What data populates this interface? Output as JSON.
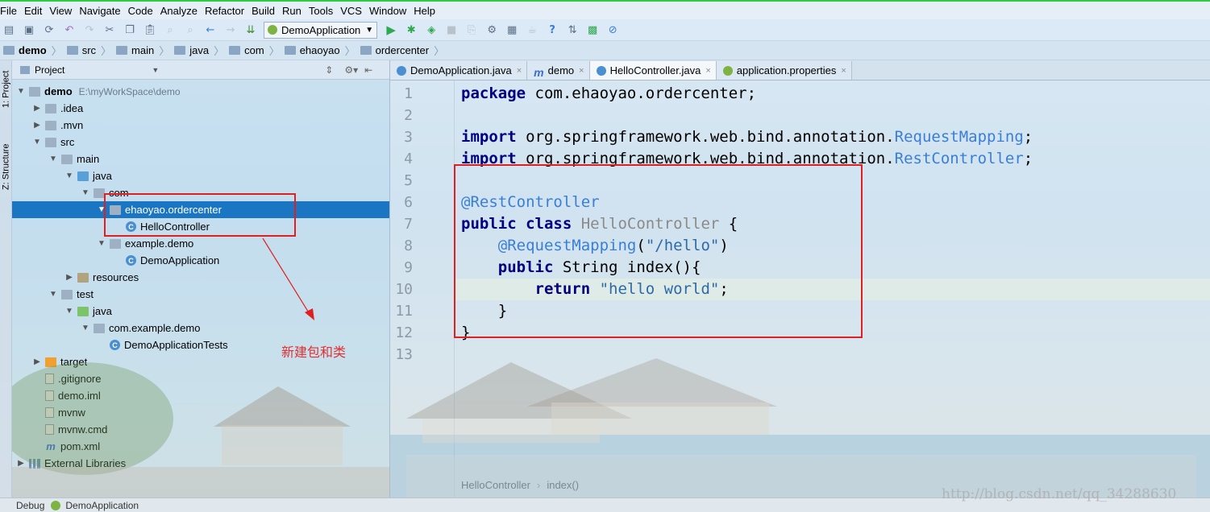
{
  "menu": [
    "File",
    "Edit",
    "View",
    "Navigate",
    "Code",
    "Analyze",
    "Refactor",
    "Build",
    "Run",
    "Tools",
    "VCS",
    "Window",
    "Help"
  ],
  "toolbar": {
    "run_config": "DemoApplication"
  },
  "breadcrumbs": [
    "demo",
    "src",
    "main",
    "java",
    "com",
    "ehaoyao",
    "ordercenter"
  ],
  "side_tabs": {
    "project": "1: Project",
    "structure": "Z: Structure"
  },
  "project": {
    "header": "Project",
    "tree": [
      {
        "label": "demo",
        "path": "E:\\myWorkSpace\\demo",
        "bold": true,
        "icon": "folder",
        "depth": 0,
        "open": true
      },
      {
        "label": ".idea",
        "icon": "folder",
        "depth": 1,
        "open": false
      },
      {
        "label": ".mvn",
        "icon": "folder",
        "depth": 1,
        "open": false
      },
      {
        "label": "src",
        "icon": "folder",
        "depth": 1,
        "open": true
      },
      {
        "label": "main",
        "icon": "folder",
        "depth": 2,
        "open": true
      },
      {
        "label": "java",
        "icon": "folder-blue",
        "depth": 3,
        "open": true
      },
      {
        "label": "com",
        "icon": "folder",
        "depth": 4,
        "open": true
      },
      {
        "label": "ehaoyao.ordercenter",
        "icon": "folder",
        "depth": 5,
        "open": true,
        "selected": true
      },
      {
        "label": "HelloController",
        "icon": "class",
        "depth": 6
      },
      {
        "label": "example.demo",
        "icon": "folder",
        "depth": 5,
        "open": true
      },
      {
        "label": "DemoApplication",
        "icon": "class",
        "depth": 6
      },
      {
        "label": "resources",
        "icon": "folder-res",
        "depth": 3,
        "open": false
      },
      {
        "label": "test",
        "icon": "folder",
        "depth": 2,
        "open": true
      },
      {
        "label": "java",
        "icon": "folder-green",
        "depth": 3,
        "open": true
      },
      {
        "label": "com.example.demo",
        "icon": "folder",
        "depth": 4,
        "open": true
      },
      {
        "label": "DemoApplicationTests",
        "icon": "class",
        "depth": 5
      },
      {
        "label": "target",
        "icon": "folder-orange",
        "depth": 1,
        "open": false
      },
      {
        "label": ".gitignore",
        "icon": "file",
        "depth": 1
      },
      {
        "label": "demo.iml",
        "icon": "file",
        "depth": 1
      },
      {
        "label": "mvnw",
        "icon": "file",
        "depth": 1
      },
      {
        "label": "mvnw.cmd",
        "icon": "file",
        "depth": 1
      },
      {
        "label": "pom.xml",
        "icon": "maven",
        "depth": 1
      },
      {
        "label": "External Libraries",
        "icon": "lib",
        "depth": 0,
        "open": false
      }
    ]
  },
  "tabs": [
    {
      "label": "DemoApplication.java",
      "icon": "class",
      "active": false
    },
    {
      "label": "demo",
      "icon": "maven",
      "active": false
    },
    {
      "label": "HelloController.java",
      "icon": "class",
      "active": true
    },
    {
      "label": "application.properties",
      "icon": "leaf",
      "active": false
    }
  ],
  "code": [
    [
      [
        "kw",
        "package"
      ],
      [
        "p",
        " com.ehaoyao.ordercenter;"
      ]
    ],
    [],
    [
      [
        "kw",
        "import"
      ],
      [
        "p",
        " org.springframework.web.bind.annotation."
      ],
      [
        "ann",
        "RequestMapping"
      ],
      [
        "p",
        ";"
      ]
    ],
    [
      [
        "kw",
        "import"
      ],
      [
        "p",
        " org.springframework.web.bind.annotation."
      ],
      [
        "ann",
        "RestController"
      ],
      [
        "p",
        ";"
      ]
    ],
    [],
    [
      [
        "ann",
        "@RestController"
      ]
    ],
    [
      [
        "kw",
        "public class"
      ],
      [
        "p",
        " "
      ],
      [
        "dim",
        "HelloController"
      ],
      [
        "p",
        " {"
      ]
    ],
    [
      [
        "p",
        "    "
      ],
      [
        "ann",
        "@RequestMapping"
      ],
      [
        "p",
        "("
      ],
      [
        "str",
        "\"/hello\""
      ],
      [
        "p",
        ")"
      ]
    ],
    [
      [
        "p",
        "    "
      ],
      [
        "kw",
        "public"
      ],
      [
        "p",
        " String index(){"
      ]
    ],
    [
      [
        "p",
        "        "
      ],
      [
        "kw",
        "return"
      ],
      [
        "p",
        " "
      ],
      [
        "str",
        "\"hello world\""
      ],
      [
        "p",
        ";"
      ]
    ],
    [
      [
        "p",
        "    }"
      ]
    ],
    [
      [
        "p",
        "}"
      ]
    ],
    []
  ],
  "line_numbers": [
    "1",
    "2",
    "3",
    "4",
    "5",
    "6",
    "7",
    "8",
    "9",
    "10",
    "11",
    "12",
    "13"
  ],
  "editor_breadcrumb": [
    "HelloController",
    "index()"
  ],
  "annotation_note": "新建包和类",
  "status": {
    "debug": "Debug",
    "app": "DemoApplication"
  },
  "watermark": "http://blog.csdn.net/qq_34288630",
  "colors": {
    "selection": "#1a75c2",
    "keyword": "#000080",
    "annotation": "#3a7fd5",
    "highlight_box": "#e02020",
    "accent_top": "#2ecc40"
  }
}
